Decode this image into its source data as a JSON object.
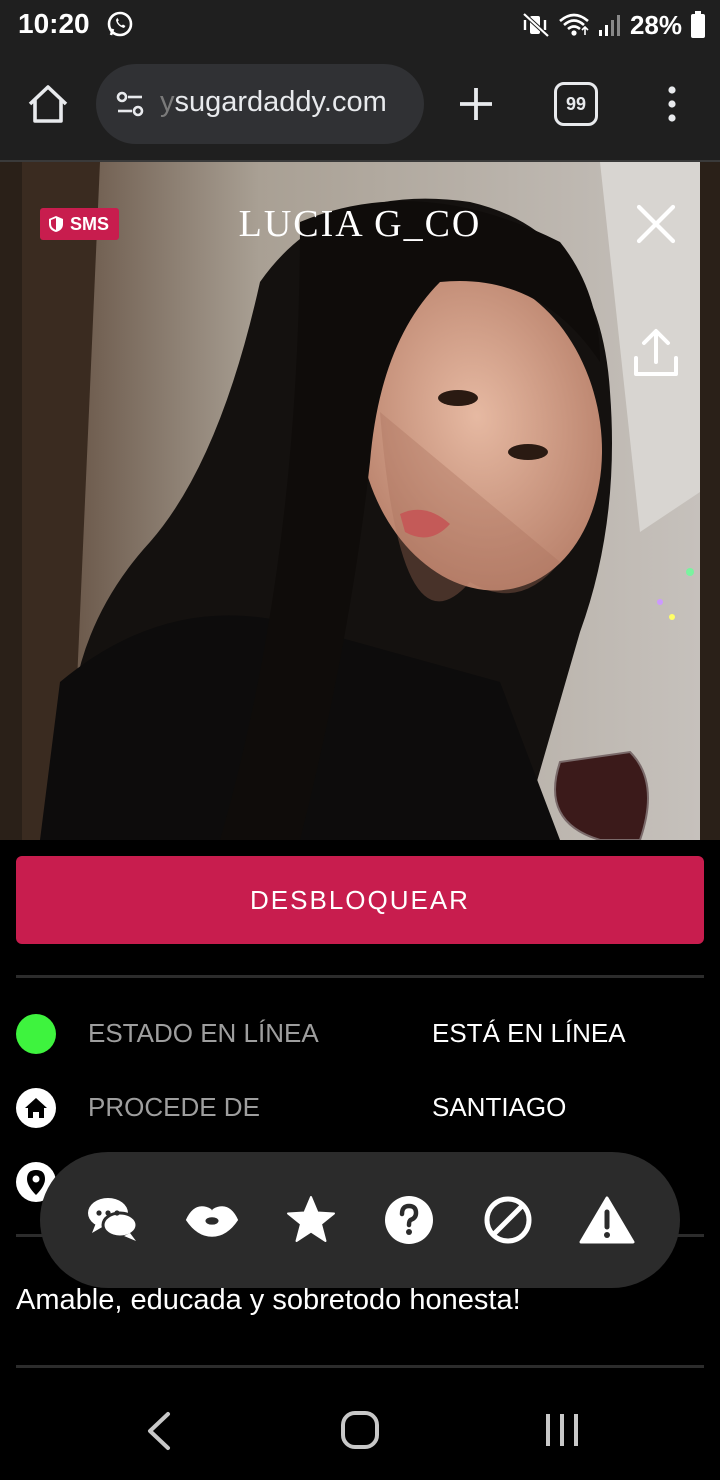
{
  "status_bar": {
    "time": "10:20",
    "battery_text": "28%",
    "icons": [
      "whatsapp-icon",
      "mute-vibrate-icon",
      "wifi-icon",
      "signal-icon",
      "battery-icon"
    ]
  },
  "browser": {
    "url_visible": "sugardaddy.com",
    "url_faded_prefix": "y",
    "tab_count": "99"
  },
  "profile": {
    "badge_label": "SMS",
    "name": "LUCIA G_CO"
  },
  "actions": {
    "unlock_label": "DESBLOQUEAR"
  },
  "info": [
    {
      "label": "ESTADO EN LÍNEA",
      "value": "ESTÁ EN LÍNEA",
      "icon": "online-status-dot"
    },
    {
      "label": "PROCEDE DE",
      "value": "SANTIAGO",
      "icon": "home-icon"
    }
  ],
  "action_bar": {
    "items": [
      "chat-icon",
      "kiss-icon",
      "star-icon",
      "help-icon",
      "block-icon",
      "warning-icon"
    ]
  },
  "bio": "Amable, educada y sobretodo honesta!",
  "colors": {
    "accent": "#c81d4e",
    "online": "#3ef33e",
    "background": "#000000",
    "chrome_bar": "#1f1f1f"
  }
}
